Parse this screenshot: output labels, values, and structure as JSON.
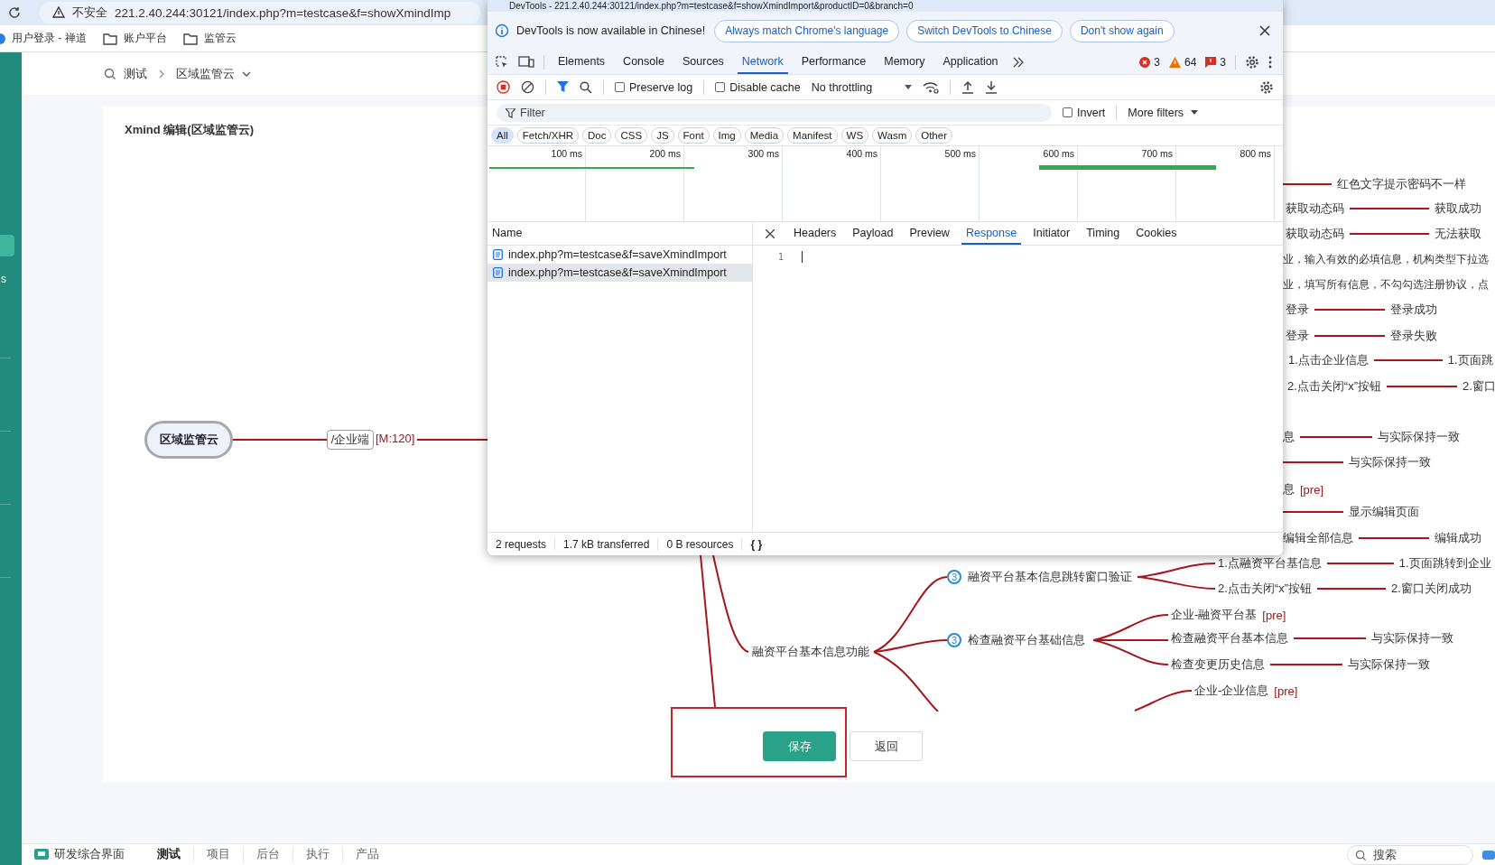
{
  "browser": {
    "security": "不安全",
    "url": "221.2.40.244:30121/index.php?m=testcase&f=showXmindImp"
  },
  "bookmarks": [
    {
      "kind": "page",
      "label": "用户登录 - 禅道"
    },
    {
      "kind": "folder",
      "label": "账户平台"
    },
    {
      "kind": "folder",
      "label": "监管云"
    }
  ],
  "sidebar": {
    "text": "s"
  },
  "breadcrumb": [
    "测试",
    "区域监管云"
  ],
  "editor": {
    "title": "Xmind 编辑(区域监管云)"
  },
  "mindmap": {
    "root": "区域监管云",
    "branch": "/企业端",
    "branch_tag": "[M:120]",
    "topics": [
      {
        "label": "融资平台基本信息功能"
      },
      {
        "label": "融资平台基本信息跳转窗口验证",
        "badge": "3"
      },
      {
        "label": "检查融资平台基础信息",
        "badge": "3"
      }
    ],
    "rows": [
      {
        "kind": "pair",
        "right": "红色文字提示密码不一样"
      },
      {
        "kind": "pair",
        "left": "获取动态码",
        "right": "获取成功"
      },
      {
        "kind": "pair",
        "left": "获取动态码",
        "right": "无法获取"
      },
      {
        "kind": "text",
        "left": "业，输入有效的必填信息，机构类型下拉选"
      },
      {
        "kind": "text",
        "left": "业，填写所有信息，不勾勾选注册协议，点"
      },
      {
        "kind": "pair",
        "left": "登录",
        "right": "登录成功"
      },
      {
        "kind": "pair",
        "left": "登录",
        "right": "登录失败"
      },
      {
        "kind": "pair",
        "left": "1.点击企业信息",
        "right": "1.页面跳"
      },
      {
        "kind": "pair",
        "left": "2.点击关闭“x”按钮",
        "right": "2.窗口"
      },
      {
        "kind": "pair",
        "left": "息",
        "right": "与实际保持一致"
      },
      {
        "kind": "pair",
        "right": "与实际保持一致"
      },
      {
        "kind": "tagged",
        "left": "息",
        "tag": "[pre]"
      },
      {
        "kind": "pair",
        "right": "显示编辑页面"
      },
      {
        "kind": "pair",
        "left": "编辑全部信息",
        "right": "编辑成功"
      },
      {
        "kind": "pair",
        "left": "1.点融资平台基信息",
        "right": "1.页面跳转到企业"
      },
      {
        "kind": "pair",
        "left": "2.点击关闭“x”按钮",
        "right": "2.窗口关闭成功"
      },
      {
        "kind": "tagged",
        "left": "企业-融资平台基",
        "tag": "[pre]"
      },
      {
        "kind": "pair",
        "left": "检查融资平台基本信息",
        "right": "与实际保持一致"
      },
      {
        "kind": "pair",
        "left": "检查变更历史信息",
        "right": "与实际保持一致"
      },
      {
        "kind": "tagged",
        "left": "企业-企业信息",
        "tag": "[pre]"
      }
    ]
  },
  "actions": [
    {
      "kind": "primary",
      "label": "保存"
    },
    {
      "kind": "secondary",
      "label": "返回"
    }
  ],
  "footer": {
    "app": "研发综合界面",
    "tabs": [
      {
        "label": "测试",
        "selected": true
      },
      {
        "label": "项目",
        "selected": false
      },
      {
        "label": "后台",
        "selected": false
      },
      {
        "label": "执行",
        "selected": false
      },
      {
        "label": "产品",
        "selected": false
      }
    ],
    "search_placeholder": "搜索"
  },
  "devtools": {
    "title": "DevTools - 221.2.40.244:30121/index.php?m=testcase&f=showXmindImport&productID=0&branch=0",
    "infobar": {
      "message": "DevTools is now available in Chinese!",
      "buttons": [
        "Always match Chrome's language",
        "Switch DevTools to Chinese",
        "Don't show again"
      ]
    },
    "tabs": [
      {
        "label": "Elements",
        "selected": false
      },
      {
        "label": "Console",
        "selected": false
      },
      {
        "label": "Sources",
        "selected": false
      },
      {
        "label": "Network",
        "selected": true
      },
      {
        "label": "Performance",
        "selected": false
      },
      {
        "label": "Memory",
        "selected": false
      },
      {
        "label": "Application",
        "selected": false
      }
    ],
    "counts": {
      "errors": "3",
      "warnings": "64",
      "issues": "3"
    },
    "toolbar": {
      "preserve_log": false,
      "preserve_label": "Preserve log",
      "disable_cache": false,
      "cache_label": "Disable cache",
      "throttling": "No throttling"
    },
    "filter": {
      "placeholder": "Filter",
      "invert": false,
      "invert_label": "Invert",
      "more": "More filters"
    },
    "types": [
      {
        "label": "All",
        "selected": true
      },
      {
        "label": "Fetch/XHR",
        "selected": false
      },
      {
        "label": "Doc",
        "selected": false
      },
      {
        "label": "CSS",
        "selected": false
      },
      {
        "label": "JS",
        "selected": false
      },
      {
        "label": "Font",
        "selected": false
      },
      {
        "label": "Img",
        "selected": false
      },
      {
        "label": "Media",
        "selected": false
      },
      {
        "label": "Manifest",
        "selected": false
      },
      {
        "label": "WS",
        "selected": false
      },
      {
        "label": "Wasm",
        "selected": false
      },
      {
        "label": "Other",
        "selected": false
      }
    ],
    "timeline_ticks": [
      "100 ms",
      "200 ms",
      "300 ms",
      "400 ms",
      "500 ms",
      "600 ms",
      "700 ms",
      "800 ms"
    ],
    "name_header": "Name",
    "requests": [
      {
        "name": "index.php?m=testcase&f=saveXmindImport",
        "selected": false
      },
      {
        "name": "index.php?m=testcase&f=saveXmindImport",
        "selected": true
      }
    ],
    "detail_tabs": [
      {
        "label": "Headers",
        "selected": false
      },
      {
        "label": "Payload",
        "selected": false
      },
      {
        "label": "Preview",
        "selected": false
      },
      {
        "label": "Response",
        "selected": true
      },
      {
        "label": "Initiator",
        "selected": false
      },
      {
        "label": "Timing",
        "selected": false
      },
      {
        "label": "Cookies",
        "selected": false
      }
    ],
    "response_lines": [
      "1"
    ],
    "status": [
      "2 requests",
      "1.7 kB transferred",
      "0 B resources"
    ],
    "pretty_print": "{ }"
  }
}
